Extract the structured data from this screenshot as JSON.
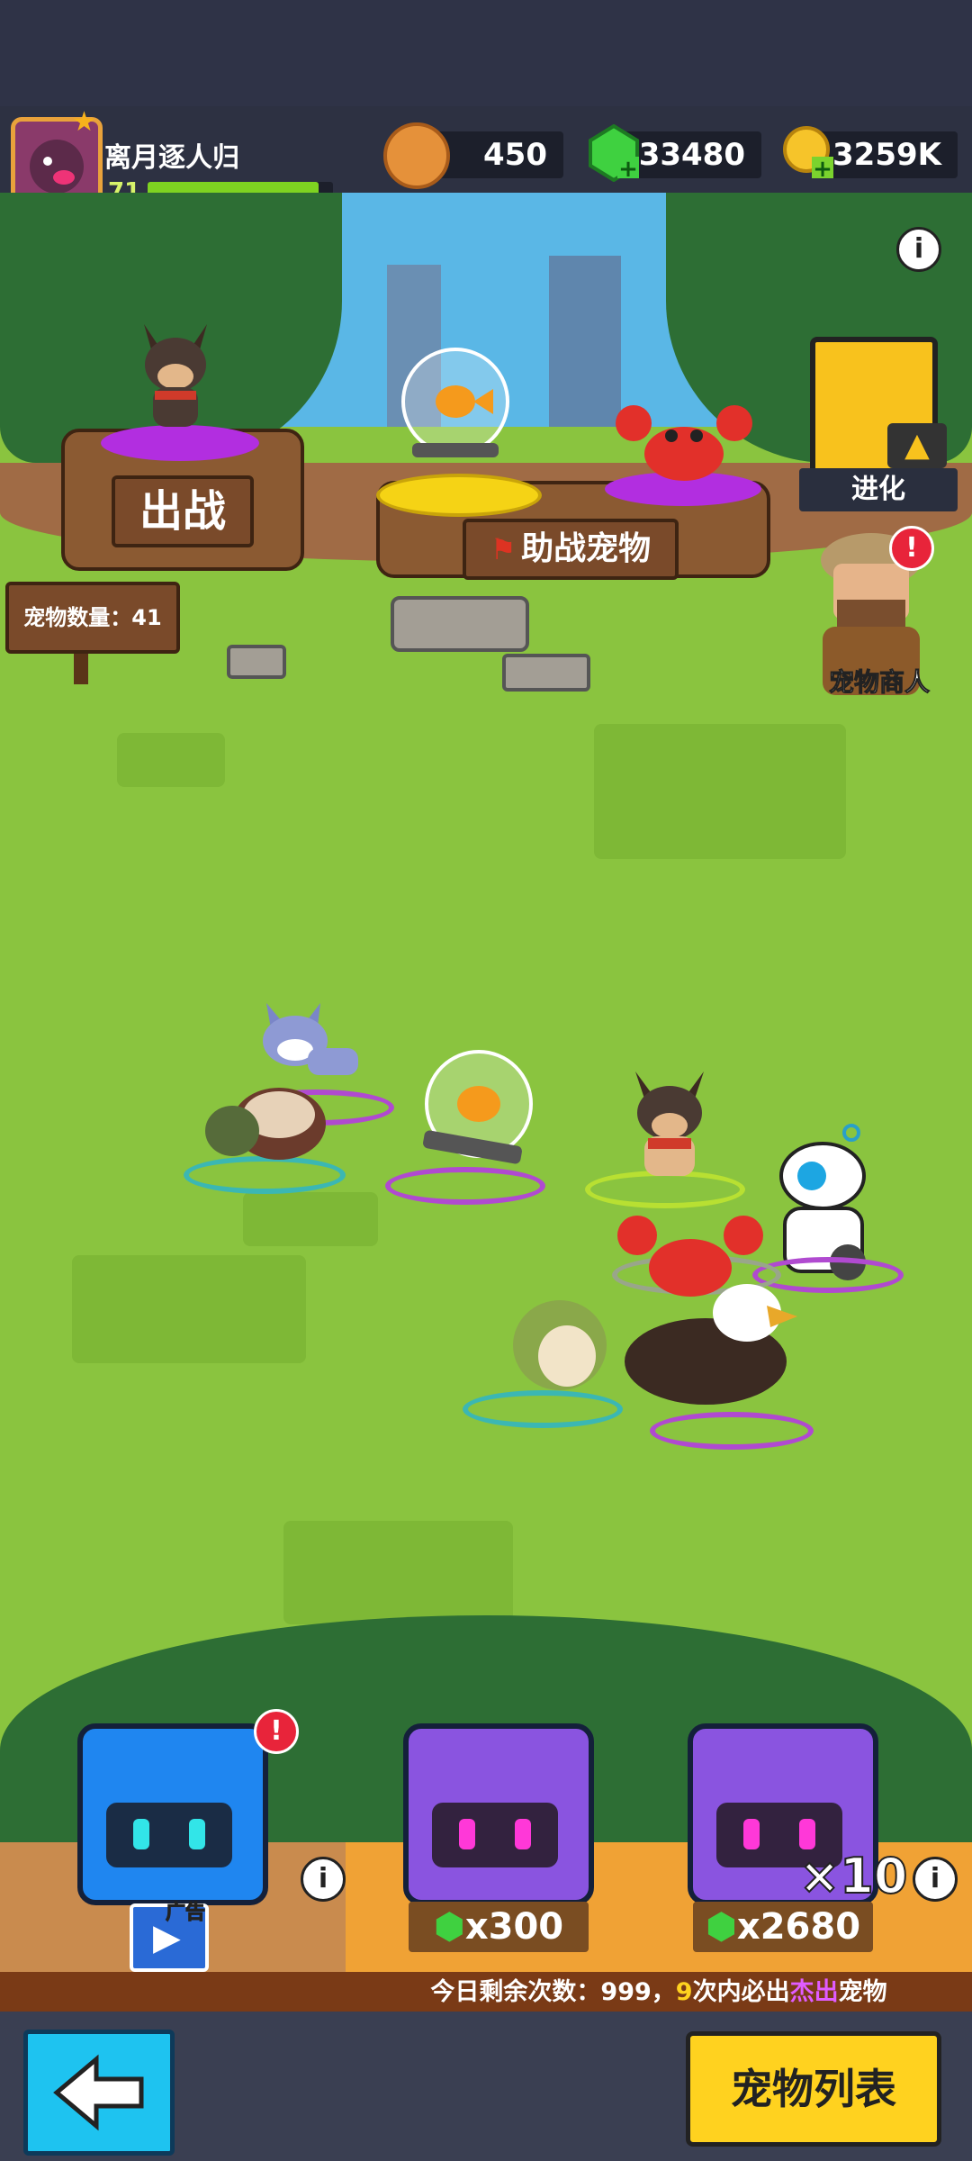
{
  "player": {
    "name": "离月逐人归",
    "level": "71",
    "xp_fraction": 0.92
  },
  "resources": {
    "food": {
      "icon": "paw-coin-icon",
      "value": "450"
    },
    "gems": {
      "icon": "green-gem-plus-icon",
      "value": "33480"
    },
    "gold": {
      "icon": "gold-coin-plus-icon",
      "value": "3259K"
    }
  },
  "scene": {
    "deploy_label": "出战",
    "assist_label": "助战宠物",
    "pet_count_label": "宠物数量：41",
    "evolve_label": "进化",
    "merchant_label": "宠物商人",
    "alert_mark": "!",
    "info_mark": "i"
  },
  "chests": {
    "ad_label": "广告",
    "purple_price": "x300",
    "purple10_price": "x2680",
    "multiplier": "×10",
    "footer_parts": [
      "今日剩余次数：999，",
      "9",
      "次内必出",
      "杰出",
      "宠物"
    ]
  },
  "nav": {
    "pet_list_label": "宠物列表",
    "back_icon": "arrow-left-icon"
  },
  "colors": {
    "accent_yellow": "#ffd21f",
    "back_cyan": "#1ec3f0",
    "grass": "#8ac43f",
    "highlight_purple": "#c040ff"
  }
}
